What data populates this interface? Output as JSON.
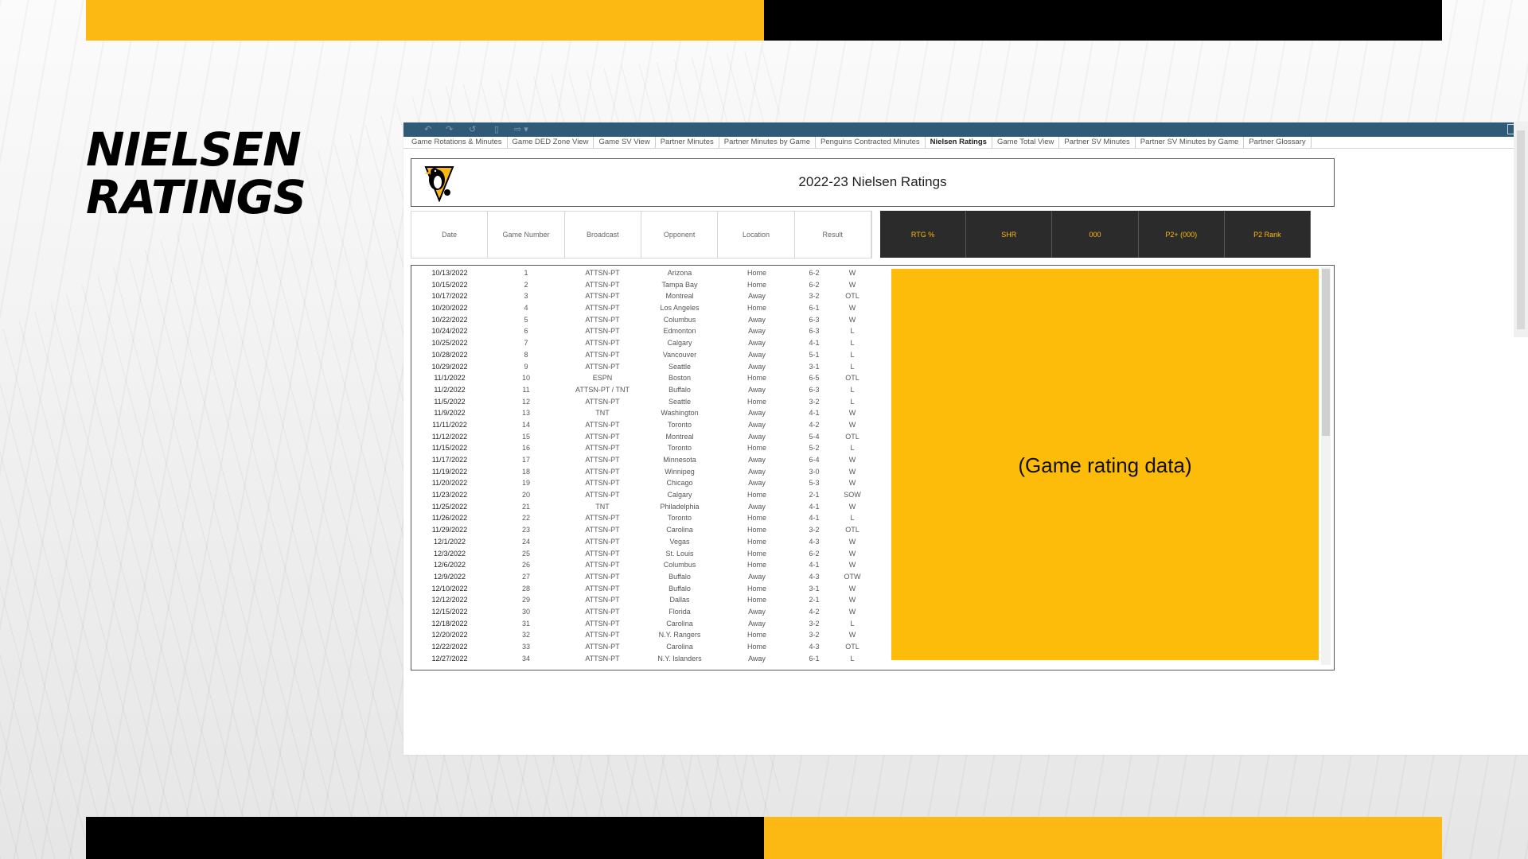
{
  "slide": {
    "title_line1": "NIELSEN",
    "title_line2": "RATINGS"
  },
  "colors": {
    "brand_yellow": "#fdb913",
    "brand_black": "#000000",
    "toolbar": "#2f5b78",
    "placeholder": "#fdbc0a"
  },
  "tabs": [
    {
      "label": "Game Rotations & Minutes",
      "active": false
    },
    {
      "label": "Game DED Zone View",
      "active": false
    },
    {
      "label": "Game SV View",
      "active": false
    },
    {
      "label": "Partner Minutes",
      "active": false
    },
    {
      "label": "Partner Minutes by Game",
      "active": false
    },
    {
      "label": "Penguins Contracted Minutes",
      "active": false
    },
    {
      "label": "Nielsen Ratings",
      "active": true
    },
    {
      "label": "Game Total View",
      "active": false
    },
    {
      "label": "Partner SV Minutes",
      "active": false
    },
    {
      "label": "Partner SV Minutes by Game",
      "active": false
    },
    {
      "label": "Partner Glossary",
      "active": false
    }
  ],
  "dashboard": {
    "title": "2022-23 Nielsen Ratings",
    "placeholder": "(Game rating data)",
    "columns": [
      "Date",
      "Game Number",
      "Broadcast",
      "Opponent",
      "Location",
      "Result"
    ],
    "metrics": [
      "RTG %",
      "SHR",
      "000",
      "P2+ (000)",
      "P2 Rank"
    ]
  },
  "games": [
    [
      "10/13/2022",
      "1",
      "ATTSN-PT",
      "Arizona",
      "Home",
      "6-2",
      "W"
    ],
    [
      "10/15/2022",
      "2",
      "ATTSN-PT",
      "Tampa Bay",
      "Home",
      "6-2",
      "W"
    ],
    [
      "10/17/2022",
      "3",
      "ATTSN-PT",
      "Montreal",
      "Away",
      "3-2",
      "OTL"
    ],
    [
      "10/20/2022",
      "4",
      "ATTSN-PT",
      "Los Angeles",
      "Home",
      "6-1",
      "W"
    ],
    [
      "10/22/2022",
      "5",
      "ATTSN-PT",
      "Columbus",
      "Away",
      "6-3",
      "W"
    ],
    [
      "10/24/2022",
      "6",
      "ATTSN-PT",
      "Edmonton",
      "Away",
      "6-3",
      "L"
    ],
    [
      "10/25/2022",
      "7",
      "ATTSN-PT",
      "Calgary",
      "Away",
      "4-1",
      "L"
    ],
    [
      "10/28/2022",
      "8",
      "ATTSN-PT",
      "Vancouver",
      "Away",
      "5-1",
      "L"
    ],
    [
      "10/29/2022",
      "9",
      "ATTSN-PT",
      "Seattle",
      "Away",
      "3-1",
      "L"
    ],
    [
      "11/1/2022",
      "10",
      "ESPN",
      "Boston",
      "Home",
      "6-5",
      "OTL"
    ],
    [
      "11/2/2022",
      "11",
      "ATTSN-PT / TNT",
      "Buffalo",
      "Away",
      "6-3",
      "L"
    ],
    [
      "11/5/2022",
      "12",
      "ATTSN-PT",
      "Seattle",
      "Home",
      "3-2",
      "L"
    ],
    [
      "11/9/2022",
      "13",
      "TNT",
      "Washington",
      "Away",
      "4-1",
      "W"
    ],
    [
      "11/11/2022",
      "14",
      "ATTSN-PT",
      "Toronto",
      "Away",
      "4-2",
      "W"
    ],
    [
      "11/12/2022",
      "15",
      "ATTSN-PT",
      "Montreal",
      "Away",
      "5-4",
      "OTL"
    ],
    [
      "11/15/2022",
      "16",
      "ATTSN-PT",
      "Toronto",
      "Home",
      "5-2",
      "L"
    ],
    [
      "11/17/2022",
      "17",
      "ATTSN-PT",
      "Minnesota",
      "Away",
      "6-4",
      "W"
    ],
    [
      "11/19/2022",
      "18",
      "ATTSN-PT",
      "Winnipeg",
      "Away",
      "3-0",
      "W"
    ],
    [
      "11/20/2022",
      "19",
      "ATTSN-PT",
      "Chicago",
      "Away",
      "5-3",
      "W"
    ],
    [
      "11/23/2022",
      "20",
      "ATTSN-PT",
      "Calgary",
      "Home",
      "2-1",
      "SOW"
    ],
    [
      "11/25/2022",
      "21",
      "TNT",
      "Philadelphia",
      "Away",
      "4-1",
      "W"
    ],
    [
      "11/26/2022",
      "22",
      "ATTSN-PT",
      "Toronto",
      "Home",
      "4-1",
      "L"
    ],
    [
      "11/29/2022",
      "23",
      "ATTSN-PT",
      "Carolina",
      "Home",
      "3-2",
      "OTL"
    ],
    [
      "12/1/2022",
      "24",
      "ATTSN-PT",
      "Vegas",
      "Home",
      "4-3",
      "W"
    ],
    [
      "12/3/2022",
      "25",
      "ATTSN-PT",
      "St. Louis",
      "Home",
      "6-2",
      "W"
    ],
    [
      "12/6/2022",
      "26",
      "ATTSN-PT",
      "Columbus",
      "Home",
      "4-1",
      "W"
    ],
    [
      "12/9/2022",
      "27",
      "ATTSN-PT",
      "Buffalo",
      "Away",
      "4-3",
      "OTW"
    ],
    [
      "12/10/2022",
      "28",
      "ATTSN-PT",
      "Buffalo",
      "Home",
      "3-1",
      "W"
    ],
    [
      "12/12/2022",
      "29",
      "ATTSN-PT",
      "Dallas",
      "Home",
      "2-1",
      "W"
    ],
    [
      "12/15/2022",
      "30",
      "ATTSN-PT",
      "Florida",
      "Away",
      "4-2",
      "W"
    ],
    [
      "12/18/2022",
      "31",
      "ATTSN-PT",
      "Carolina",
      "Away",
      "3-2",
      "L"
    ],
    [
      "12/20/2022",
      "32",
      "ATTSN-PT",
      "N.Y. Rangers",
      "Home",
      "3-2",
      "W"
    ],
    [
      "12/22/2022",
      "33",
      "ATTSN-PT",
      "Carolina",
      "Home",
      "4-3",
      "OTL"
    ],
    [
      "12/27/2022",
      "34",
      "ATTSN-PT",
      "N.Y. Islanders",
      "Away",
      "6-1",
      "L"
    ]
  ]
}
